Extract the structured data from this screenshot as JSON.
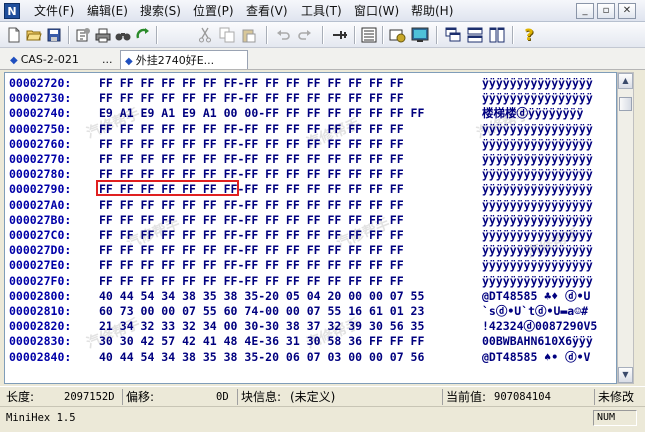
{
  "menu": {
    "app_icon_letter": "N",
    "items": [
      "文件(F)",
      "编辑(E)",
      "搜索(S)",
      "位置(P)",
      "查看(V)",
      "工具(T)",
      "窗口(W)",
      "帮助(H)"
    ]
  },
  "toolbar": {
    "icons": [
      "new-file-icon",
      "open-folder-icon",
      "save-icon",
      "properties-icon",
      "print-icon",
      "find-icon",
      "refresh-icon",
      "cut-icon",
      "copy-icon",
      "paste-icon",
      "undo-icon",
      "redo-icon",
      "bookmark-icon",
      "list-icon",
      "tools-icon",
      "screen-icon",
      "cascade-icon",
      "tile-horizontal-icon",
      "tile-vertical-icon",
      "help-icon"
    ]
  },
  "tabs": [
    {
      "label": "CAS-2-021"
    },
    {
      "label": "..."
    },
    {
      "label": "外挂2740好E..."
    }
  ],
  "hex": {
    "rows": [
      {
        "addr": "00002720:",
        "bytes": "FF FF FF FF FF FF FF-FF FF FF FF FF FF FF FF",
        "ascii": "ÿÿÿÿÿÿÿÿÿÿÿÿÿÿÿÿ"
      },
      {
        "addr": "00002730:",
        "bytes": "FF FF FF FF FF FF FF-FF FF FF FF FF FF FF FF",
        "ascii": "ÿÿÿÿÿÿÿÿÿÿÿÿÿÿÿÿ"
      },
      {
        "addr": "00002740:",
        "bytes": "E9 A1 E9 A1 E9 A1 00 00-FF FF FF FF FF FF FF FF",
        "ascii": "楼梯楼ⓓÿÿÿÿÿÿÿÿ"
      },
      {
        "addr": "00002750:",
        "bytes": "FF FF FF FF FF FF FF-FF FF FF FF FF FF FF FF",
        "ascii": "ÿÿÿÿÿÿÿÿÿÿÿÿÿÿÿÿ"
      },
      {
        "addr": "00002760:",
        "bytes": "FF FF FF FF FF FF FF-FF FF FF FF FF FF FF FF",
        "ascii": "ÿÿÿÿÿÿÿÿÿÿÿÿÿÿÿÿ"
      },
      {
        "addr": "00002770:",
        "bytes": "FF FF FF FF FF FF FF-FF FF FF FF FF FF FF FF",
        "ascii": "ÿÿÿÿÿÿÿÿÿÿÿÿÿÿÿÿ"
      },
      {
        "addr": "00002780:",
        "bytes": "FF FF FF FF FF FF FF-FF FF FF FF FF FF FF FF",
        "ascii": "ÿÿÿÿÿÿÿÿÿÿÿÿÿÿÿÿ"
      },
      {
        "addr": "00002790:",
        "bytes": "FF FF FF FF FF FF FF-FF FF FF FF FF FF FF FF",
        "ascii": "ÿÿÿÿÿÿÿÿÿÿÿÿÿÿÿÿ"
      },
      {
        "addr": "000027A0:",
        "bytes": "FF FF FF FF FF FF FF-FF FF FF FF FF FF FF FF",
        "ascii": "ÿÿÿÿÿÿÿÿÿÿÿÿÿÿÿÿ"
      },
      {
        "addr": "000027B0:",
        "bytes": "FF FF FF FF FF FF FF-FF FF FF FF FF FF FF FF",
        "ascii": "ÿÿÿÿÿÿÿÿÿÿÿÿÿÿÿÿ"
      },
      {
        "addr": "000027C0:",
        "bytes": "FF FF FF FF FF FF FF-FF FF FF FF FF FF FF FF",
        "ascii": "ÿÿÿÿÿÿÿÿÿÿÿÿÿÿÿÿ"
      },
      {
        "addr": "000027D0:",
        "bytes": "FF FF FF FF FF FF FF-FF FF FF FF FF FF FF FF",
        "ascii": "ÿÿÿÿÿÿÿÿÿÿÿÿÿÿÿÿ"
      },
      {
        "addr": "000027E0:",
        "bytes": "FF FF FF FF FF FF FF-FF FF FF FF FF FF FF FF",
        "ascii": "ÿÿÿÿÿÿÿÿÿÿÿÿÿÿÿÿ"
      },
      {
        "addr": "000027F0:",
        "bytes": "FF FF FF FF FF FF FF-FF FF FF FF FF FF FF FF",
        "ascii": "ÿÿÿÿÿÿÿÿÿÿÿÿÿÿÿÿ"
      },
      {
        "addr": "00002800:",
        "bytes": "40 44 54 34 38 35 38 35-20 05 04 20 00 00 07 55",
        "ascii": "@DT48585 ♣♦ ⓓ•U"
      },
      {
        "addr": "00002810:",
        "bytes": "60 73 00 00 07 55 60 74-00 00 07 55 16 61 01 23",
        "ascii": "`sⓓ•U`tⓓ•U▬a☺#"
      },
      {
        "addr": "00002820:",
        "bytes": "21 34 32 33 32 34 00 30-30 38 37 32 39 30 56 35",
        "ascii": "!42324ⓓ0087290V5"
      },
      {
        "addr": "00002830:",
        "bytes": "30 30 42 57 42 41 48 4E-36 31 30 58 36 FF FF FF",
        "ascii": "00BWBAHN610X6ÿÿÿ"
      },
      {
        "addr": "00002840:",
        "bytes": "40 44 54 34 38 35 38 35-20 06 07 03 00 00 07 56",
        "ascii": "@DT48585 ♠• ⓓ•V"
      }
    ]
  },
  "status": {
    "length_label": "长度:",
    "length_value": "2097152D",
    "offset_label": "偏移:",
    "offset_value": "0D",
    "block_label": "块信息:",
    "block_value": "(未定义)",
    "current_label": "当前值:",
    "current_value": "907084104",
    "modified_label": "未修改",
    "version": "MiniHex 1.5",
    "num": "NUM"
  }
}
